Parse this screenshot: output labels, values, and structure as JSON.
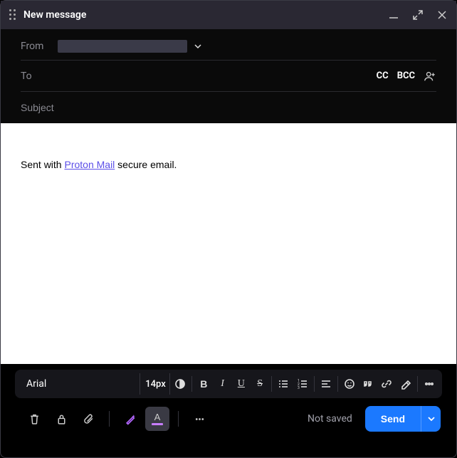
{
  "window": {
    "title": "New message"
  },
  "fields": {
    "from_label": "From",
    "from_value": "",
    "to_label": "To",
    "cc_label": "CC",
    "bcc_label": "BCC",
    "subject_placeholder": "Subject",
    "subject_value": ""
  },
  "body": {
    "prefix": "Sent with ",
    "link_text": "Proton Mail",
    "suffix": " secure email."
  },
  "toolbar": {
    "font": "Arial",
    "size": "14px"
  },
  "footer": {
    "status": "Not saved",
    "send_label": "Send"
  },
  "icons": {
    "contrast": "contrast-icon",
    "bold": "B",
    "italic": "I",
    "underline": "U",
    "strike": "S"
  }
}
